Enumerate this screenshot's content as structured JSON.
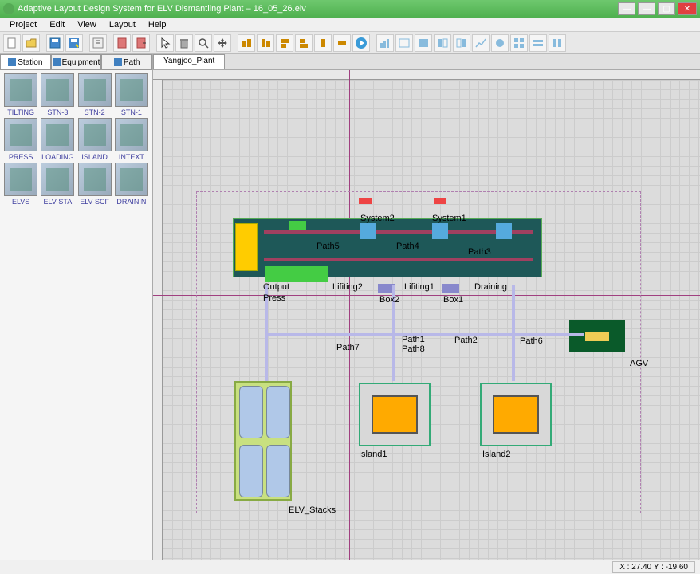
{
  "titlebar": {
    "app_title": "Adaptive Layout Design System for ELV Dismantling Plant – 16_05_26.elv"
  },
  "menus": [
    "Project",
    "Edit",
    "View",
    "Layout",
    "Help"
  ],
  "sidebar": {
    "tabs": [
      {
        "label": "Station",
        "active": true
      },
      {
        "label": "Equipment",
        "active": false
      },
      {
        "label": "Path",
        "active": false
      }
    ],
    "items": [
      {
        "label": "TILTING"
      },
      {
        "label": "STN-3"
      },
      {
        "label": "STN-2"
      },
      {
        "label": "STN-1"
      },
      {
        "label": "PRESS"
      },
      {
        "label": "LOADING"
      },
      {
        "label": "ISLAND"
      },
      {
        "label": "INTEXT"
      },
      {
        "label": "ELVS"
      },
      {
        "label": "ELV STA"
      },
      {
        "label": "ELV SCF"
      },
      {
        "label": "DRAININ"
      }
    ]
  },
  "canvas": {
    "tab": "Yangjoo_Plant",
    "labels": {
      "system2": "System2",
      "system1": "System1",
      "path5": "Path5",
      "path4": "Path4",
      "path3": "Path3",
      "output": "Output",
      "press": "Press",
      "lifting2": "Lifiting2",
      "lifting1": "Lifiting1",
      "draining": "Draining",
      "box2": "Box2",
      "box1": "Box1",
      "path7": "Path7",
      "path1": "Path1",
      "path8": "Path8",
      "path2": "Path2",
      "path6": "Path6",
      "agv": "AGV",
      "island1": "Island1",
      "island2": "Island2",
      "elv_stacks": "ELV_Stacks"
    }
  },
  "statusbar": {
    "coords": "X :   27.40 Y :   -19.60"
  },
  "toolbar_icons": [
    "new-file",
    "open-file",
    "save",
    "save-as",
    "properties",
    "report",
    "report-out",
    "cursor",
    "delete",
    "zoom",
    "pan",
    "align-left",
    "align-right",
    "align-top",
    "align-bottom",
    "distribute-h",
    "distribute-v",
    "play",
    "chart1",
    "chart2",
    "chart3",
    "chart4",
    "chart5",
    "chart6",
    "chart7",
    "chart8",
    "chart9",
    "chart10"
  ]
}
